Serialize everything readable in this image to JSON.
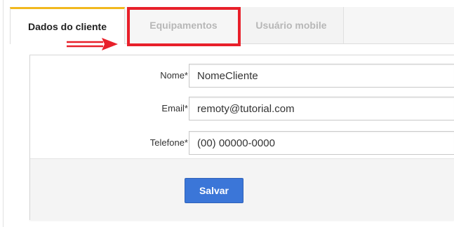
{
  "tabs": [
    {
      "label": "Dados do cliente",
      "active": true
    },
    {
      "label": "Equipamentos",
      "active": false,
      "highlighted": true
    },
    {
      "label": "Usuário mobile",
      "active": false
    }
  ],
  "form": {
    "fields": [
      {
        "label": "Nome*",
        "value": "NomeCliente"
      },
      {
        "label": "Email*",
        "value": "remoty@tutorial.com"
      },
      {
        "label": "Telefone*",
        "value": "(00) 00000-0000"
      }
    ],
    "save_label": "Salvar"
  },
  "colors": {
    "active_tab_accent": "#f1b81e",
    "highlight": "#e8202a",
    "primary_button": "#3b76d8"
  },
  "icons": {
    "annotation_arrow": "red-arrow-right-icon"
  }
}
